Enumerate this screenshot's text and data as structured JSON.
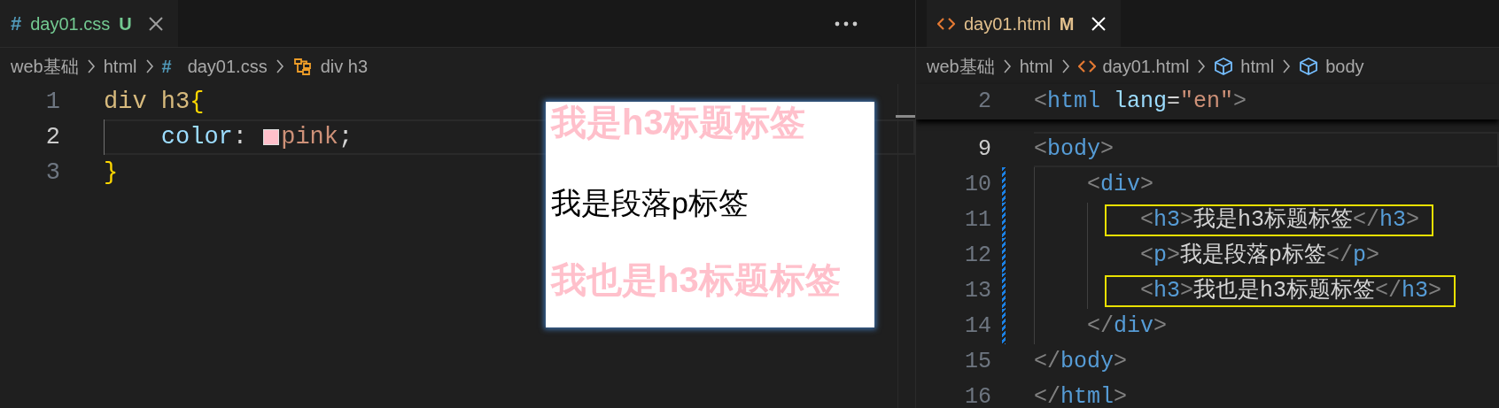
{
  "left_pane": {
    "tab": {
      "glyph": "#",
      "label": "day01.css",
      "status": "U",
      "color": "#73c991",
      "selected": true
    },
    "breadcrumbs": [
      {
        "kind": "folder",
        "label": "web基础"
      },
      {
        "kind": "folder",
        "label": "html"
      },
      {
        "kind": "css-file",
        "glyph": "#",
        "label": "day01.css"
      },
      {
        "kind": "rule",
        "label": "div h3"
      }
    ],
    "lines": [
      {
        "number": "1",
        "current": false,
        "tokens": [
          {
            "kind": "selector",
            "text": "div h3"
          },
          {
            "kind": "brace",
            "text": "{"
          }
        ],
        "children": [
          {
            "number": "2",
            "current": true,
            "tokens": [
              {
                "kind": "property",
                "text": "color"
              },
              {
                "kind": "punct",
                "text": ": "
              },
              {
                "kind": "swatch",
                "color": "#ffc0cb"
              },
              {
                "kind": "value",
                "text": "pink"
              },
              {
                "kind": "punct",
                "text": ";"
              }
            ]
          }
        ]
      },
      {
        "number": "3",
        "current": false,
        "tokens": [
          {
            "kind": "brace",
            "text": "}"
          }
        ]
      }
    ],
    "preview": [
      {
        "kind": "h3",
        "text": "我是h3标题标签"
      },
      {
        "kind": "p",
        "text": "我是段落p标签"
      },
      {
        "kind": "h3",
        "text": "我也是h3标题标签"
      }
    ]
  },
  "right_pane": {
    "tab": {
      "label": "day01.html",
      "status": "M",
      "color": "#e2c08d",
      "selected": true
    },
    "breadcrumbs": [
      {
        "kind": "folder",
        "label": "web基础"
      },
      {
        "kind": "folder",
        "label": "html"
      },
      {
        "kind": "html-file",
        "label": "day01.html"
      },
      {
        "kind": "element",
        "label": "html"
      },
      {
        "kind": "element",
        "label": "body"
      }
    ],
    "sticky_line": {
      "number": "2",
      "tokens": [
        {
          "kind": "bracket",
          "text": "<"
        },
        {
          "kind": "tag",
          "text": "html"
        },
        {
          "kind": "attr",
          "text": " lang"
        },
        {
          "kind": "punct",
          "text": "="
        },
        {
          "kind": "string",
          "text": "\"en\""
        },
        {
          "kind": "bracket",
          "text": ">"
        }
      ]
    },
    "lines": [
      {
        "number": "9",
        "current": true,
        "modified": false,
        "highlighted": false,
        "tokens": [
          {
            "kind": "bracket",
            "text": "<"
          },
          {
            "kind": "tag",
            "text": "body"
          },
          {
            "kind": "bracket",
            "text": ">"
          }
        ],
        "children": [
          {
            "number": "10",
            "current": false,
            "modified": true,
            "highlighted": false,
            "tokens": [
              {
                "kind": "bracket",
                "text": "<"
              },
              {
                "kind": "tag",
                "text": "div"
              },
              {
                "kind": "bracket",
                "text": ">"
              }
            ],
            "children": [
              {
                "number": "11",
                "current": false,
                "modified": true,
                "highlighted": true,
                "tokens": [
                  {
                    "kind": "bracket",
                    "text": "<"
                  },
                  {
                    "kind": "tag",
                    "text": "h3"
                  },
                  {
                    "kind": "bracket",
                    "text": ">"
                  },
                  {
                    "kind": "text",
                    "text": "我是h3标题标签"
                  },
                  {
                    "kind": "bracket",
                    "text": "</"
                  },
                  {
                    "kind": "tag",
                    "text": "h3"
                  },
                  {
                    "kind": "bracket",
                    "text": ">"
                  }
                ]
              },
              {
                "number": "12",
                "current": false,
                "modified": true,
                "highlighted": false,
                "tokens": [
                  {
                    "kind": "bracket",
                    "text": "<"
                  },
                  {
                    "kind": "tag",
                    "text": "p"
                  },
                  {
                    "kind": "bracket",
                    "text": ">"
                  },
                  {
                    "kind": "text",
                    "text": "我是段落p标签"
                  },
                  {
                    "kind": "bracket",
                    "text": "</"
                  },
                  {
                    "kind": "tag",
                    "text": "p"
                  },
                  {
                    "kind": "bracket",
                    "text": ">"
                  }
                ]
              },
              {
                "number": "13",
                "current": false,
                "modified": true,
                "highlighted": true,
                "tokens": [
                  {
                    "kind": "bracket",
                    "text": "<"
                  },
                  {
                    "kind": "tag",
                    "text": "h3"
                  },
                  {
                    "kind": "bracket",
                    "text": ">"
                  },
                  {
                    "kind": "text",
                    "text": "我也是h3标题标签"
                  },
                  {
                    "kind": "bracket",
                    "text": "</"
                  },
                  {
                    "kind": "tag",
                    "text": "h3"
                  },
                  {
                    "kind": "bracket",
                    "text": ">"
                  }
                ]
              }
            ]
          },
          {
            "number": "14",
            "current": false,
            "modified": true,
            "highlighted": false,
            "tokens": [
              {
                "kind": "bracket",
                "text": "</"
              },
              {
                "kind": "tag",
                "text": "div"
              },
              {
                "kind": "bracket",
                "text": ">"
              }
            ]
          }
        ]
      },
      {
        "number": "15",
        "current": false,
        "modified": false,
        "highlighted": false,
        "tokens": [
          {
            "kind": "bracket",
            "text": "</"
          },
          {
            "kind": "tag",
            "text": "body"
          },
          {
            "kind": "bracket",
            "text": ">"
          }
        ]
      },
      {
        "number": "16",
        "current": false,
        "modified": false,
        "highlighted": false,
        "tokens": [
          {
            "kind": "bracket",
            "text": "</"
          },
          {
            "kind": "tag",
            "text": "html"
          },
          {
            "kind": "bracket",
            "text": ">"
          }
        ]
      }
    ]
  }
}
